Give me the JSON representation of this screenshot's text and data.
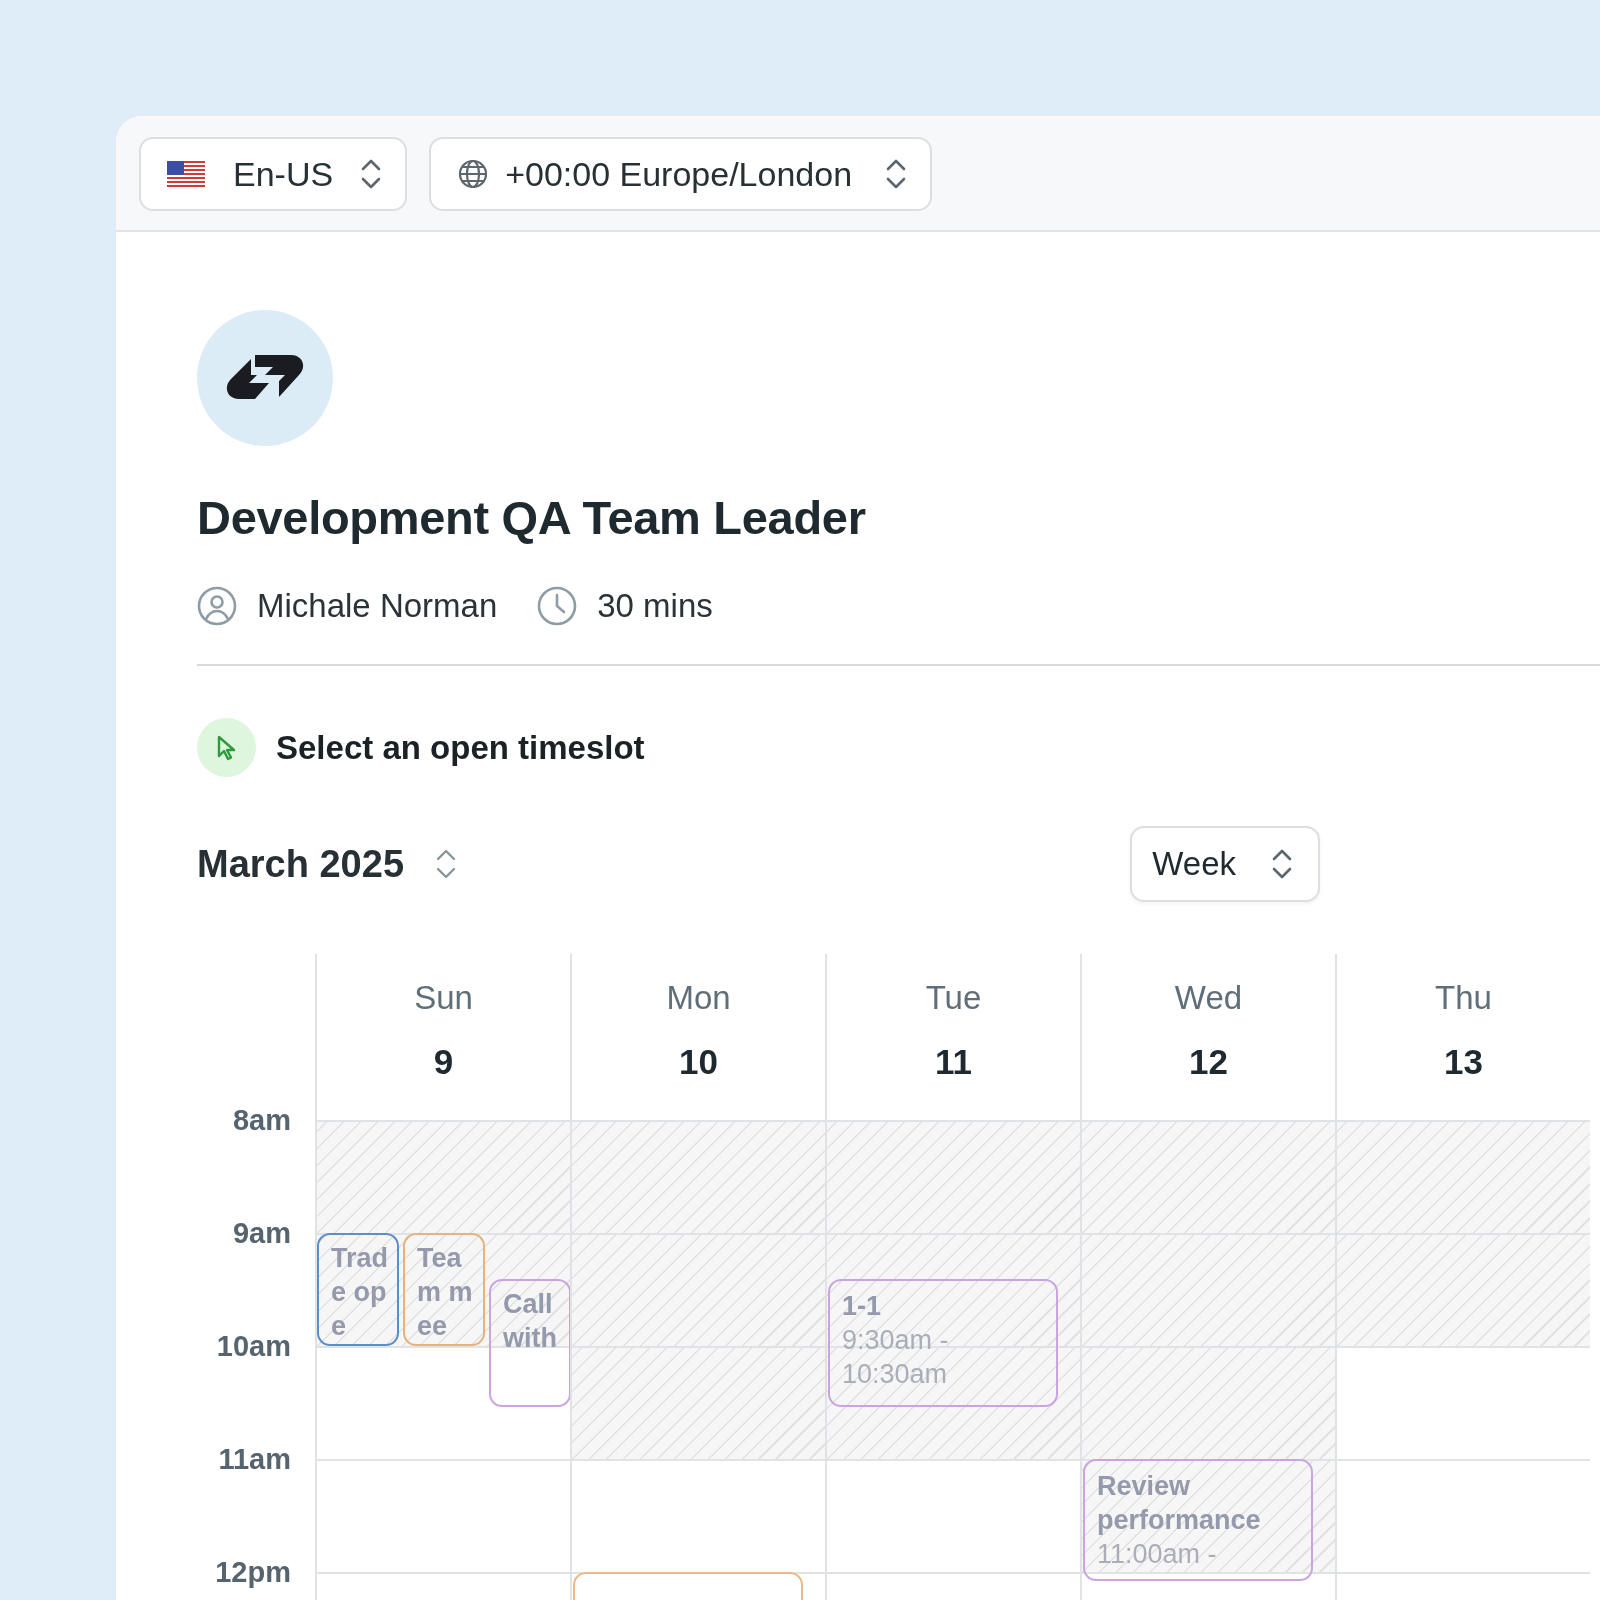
{
  "locale_select": {
    "value": "En-US"
  },
  "timezone_select": {
    "value": "+00:00 Europe/London"
  },
  "event": {
    "title": "Development QA Team Leader",
    "host": "Michale Norman",
    "duration": "30 mins"
  },
  "prompt": "Select an open timeslot",
  "calendar": {
    "month": "March 2025",
    "view": "Week",
    "hours": [
      "8am",
      "9am",
      "10am",
      "11am",
      "12pm"
    ],
    "days": [
      {
        "name": "Sun",
        "date": "9",
        "slots": [
          {
            "blocked": true
          },
          {
            "blocked": true,
            "events": [
              {
                "kind": "aligned",
                "title": "Trade ope",
                "color": "#5b8fc9"
              },
              {
                "kind": "aligned",
                "title": "Team mee",
                "color": "#e8b27a"
              },
              {
                "kind": "late",
                "title": "Call with",
                "color": "#c9a4e0"
              }
            ]
          },
          {
            "blocked": false
          },
          {
            "blocked": false
          },
          {
            "blocked": false
          }
        ]
      },
      {
        "name": "Mon",
        "date": "10",
        "slots": [
          {
            "blocked": true
          },
          {
            "blocked": true
          },
          {
            "blocked": true
          },
          {
            "blocked": false
          },
          {
            "blocked": false,
            "events": [
              {
                "kind": "aligned",
                "color": "#f0b885"
              }
            ]
          }
        ]
      },
      {
        "name": "Tue",
        "date": "11",
        "slots": [
          {
            "blocked": true
          },
          {
            "blocked": true,
            "events": [
              {
                "kind": "late",
                "title": "1-1",
                "time": "9:30am - 10:30am",
                "color": "#c9a4e0"
              }
            ]
          },
          {
            "blocked": true
          },
          {
            "blocked": false
          },
          {
            "blocked": false
          }
        ]
      },
      {
        "name": "Wed",
        "date": "12",
        "slots": [
          {
            "blocked": true
          },
          {
            "blocked": true
          },
          {
            "blocked": true
          },
          {
            "blocked": true,
            "events": [
              {
                "kind": "aligned",
                "title": "Review performance",
                "time": "11:00am -",
                "color": "#c9a4e0"
              }
            ]
          },
          {
            "blocked": false
          }
        ]
      },
      {
        "name": "Thu",
        "date": "13",
        "slots": [
          {
            "blocked": true
          },
          {
            "blocked": true
          },
          {
            "blocked": false
          },
          {
            "blocked": false
          },
          {
            "blocked": false
          }
        ]
      }
    ]
  }
}
